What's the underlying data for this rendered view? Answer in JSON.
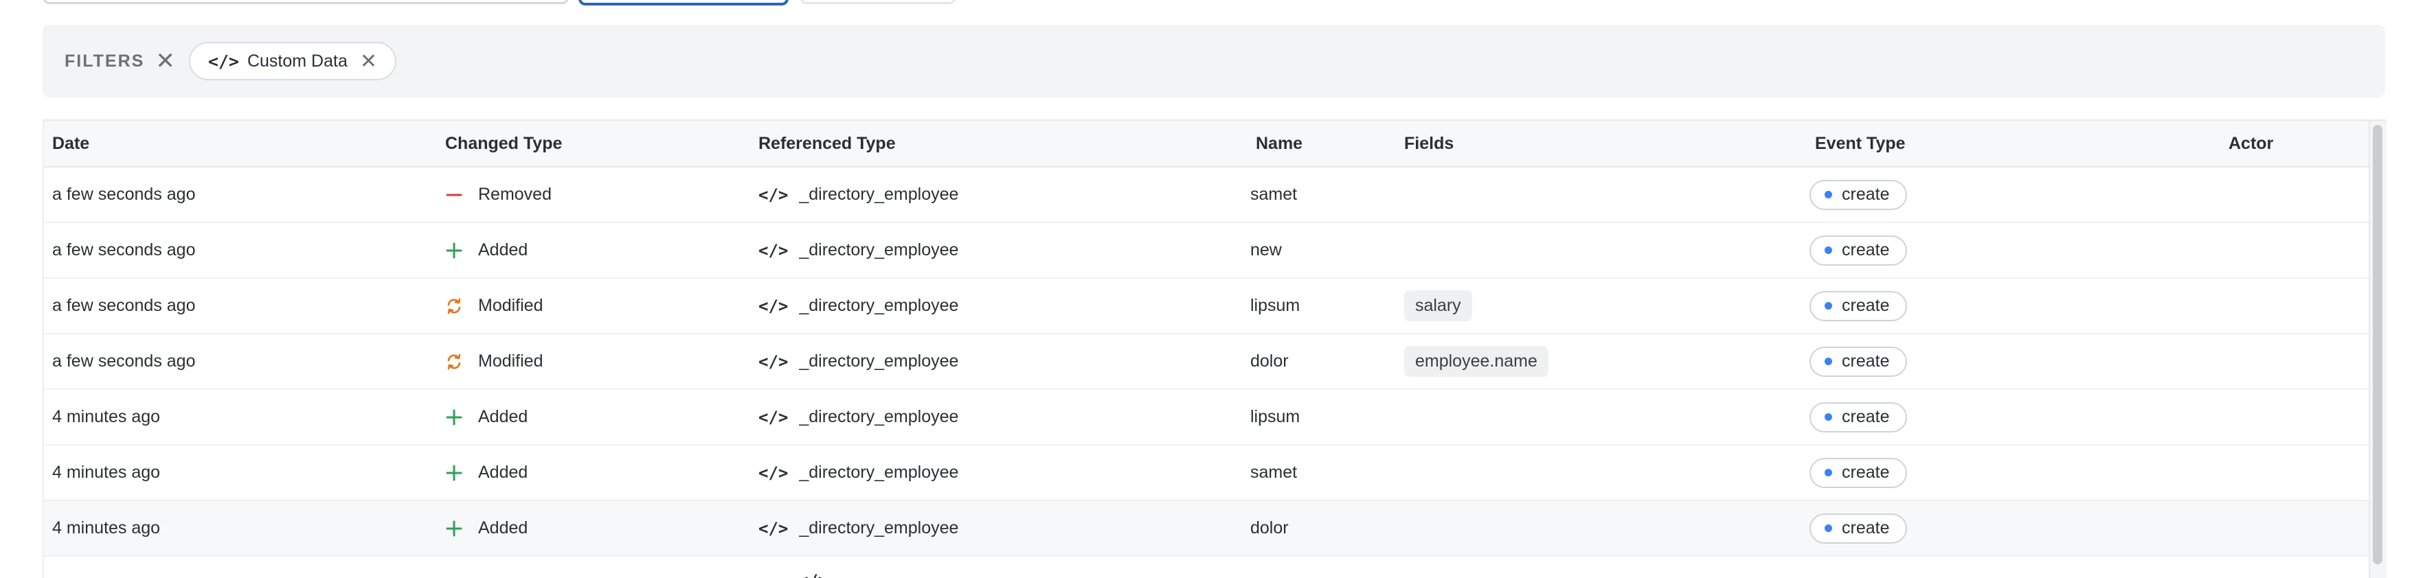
{
  "filters": {
    "label": "FILTERS",
    "clear_icon": "close-icon",
    "chips": [
      {
        "icon": "code-icon",
        "label": "Custom Data"
      }
    ]
  },
  "table": {
    "columns": [
      "Date",
      "Changed Type",
      "Referenced Type",
      "Name",
      "Fields",
      "Event Type",
      "Actor"
    ],
    "rows": [
      {
        "date": "a few seconds ago",
        "changed_type": "Removed",
        "changed_icon": "minus-icon",
        "referenced_type": "_directory_employee",
        "name": "samet",
        "fields": "",
        "event_type": "create",
        "actor": ""
      },
      {
        "date": "a few seconds ago",
        "changed_type": "Added",
        "changed_icon": "plus-icon",
        "referenced_type": "_directory_employee",
        "name": "new",
        "fields": "",
        "event_type": "create",
        "actor": ""
      },
      {
        "date": "a few seconds ago",
        "changed_type": "Modified",
        "changed_icon": "sync-icon",
        "referenced_type": "_directory_employee",
        "name": "lipsum",
        "fields": "salary",
        "event_type": "create",
        "actor": ""
      },
      {
        "date": "a few seconds ago",
        "changed_type": "Modified",
        "changed_icon": "sync-icon",
        "referenced_type": "_directory_employee",
        "name": "dolor",
        "fields": "employee.name",
        "event_type": "create",
        "actor": ""
      },
      {
        "date": "4 minutes ago",
        "changed_type": "Added",
        "changed_icon": "plus-icon",
        "referenced_type": "_directory_employee",
        "name": "lipsum",
        "fields": "",
        "event_type": "create",
        "actor": ""
      },
      {
        "date": "4 minutes ago",
        "changed_type": "Added",
        "changed_icon": "plus-icon",
        "referenced_type": "_directory_employee",
        "name": "samet",
        "fields": "",
        "event_type": "create",
        "actor": ""
      },
      {
        "date": "4 minutes ago",
        "changed_type": "Added",
        "changed_icon": "plus-icon",
        "referenced_type": "_directory_employee",
        "name": "dolor",
        "fields": "",
        "event_type": "create",
        "actor": ""
      }
    ]
  },
  "colors": {
    "removed": "#d93b3b",
    "added": "#2f9e5a",
    "modified": "#e2761b",
    "event_dot": "#3b82f6",
    "primary_outline": "#2f63b8"
  }
}
